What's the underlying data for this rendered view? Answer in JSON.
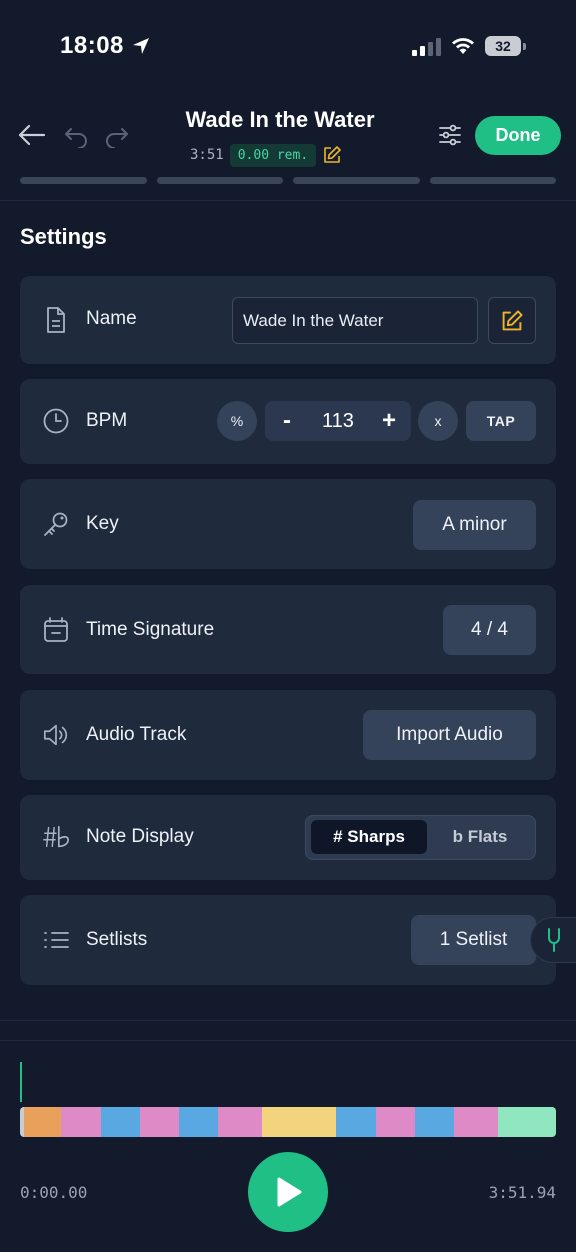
{
  "status_bar": {
    "time": "18:08",
    "battery": "32"
  },
  "header": {
    "title": "Wade In the Water",
    "duration": "3:51",
    "remaining": "0.00 rem.",
    "done_label": "Done",
    "progress_segments": 4
  },
  "settings": {
    "title": "Settings",
    "name": {
      "label": "Name",
      "value": "Wade In the Water"
    },
    "bpm": {
      "label": "BPM",
      "percent_label": "%",
      "minus": "-",
      "value": "113",
      "plus": "+",
      "multiply_label": "x",
      "tap_label": "TAP"
    },
    "key": {
      "label": "Key",
      "value": "A minor"
    },
    "time_signature": {
      "label": "Time Signature",
      "value": "4 / 4"
    },
    "audio_track": {
      "label": "Audio Track",
      "button": "Import Audio"
    },
    "note_display": {
      "label": "Note Display",
      "sharps": "# Sharps",
      "flats": "b Flats",
      "selected": "sharps"
    },
    "setlists": {
      "label": "Setlists",
      "value": "1 Setlist"
    }
  },
  "player": {
    "current_time": "0:00.00",
    "total_time": "3:51.94",
    "timeline_colors": [
      "#c8ccd4",
      "#e8a05a",
      "#dd8ac6",
      "#5aa8e2",
      "#dd8ac6",
      "#5aa8e2",
      "#dd8ac6",
      "#f2d47f",
      "#5aa8e2",
      "#dd8ac6",
      "#5aa8e2",
      "#dd8ac6",
      "#8fe6bf"
    ],
    "timeline_weights": [
      4,
      37,
      40,
      39,
      39,
      39,
      44,
      74,
      40,
      39,
      39,
      44,
      58
    ]
  },
  "colors": {
    "accent": "#1fbf86",
    "edit_icon": "#f0b429"
  }
}
